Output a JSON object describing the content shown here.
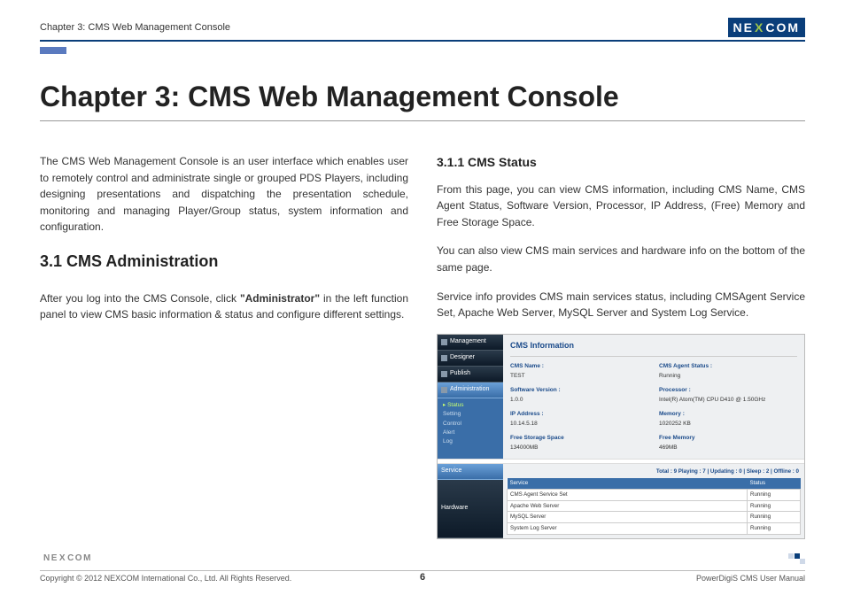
{
  "header": {
    "breadcrumb": "Chapter 3: CMS Web Management Console",
    "logo_pre": "NE",
    "logo_x": "X",
    "logo_post": "COM"
  },
  "title": "Chapter 3: CMS Web Management Console",
  "left": {
    "intro": "The CMS Web Management Console is an user interface which enables user to remotely control and administrate single or grouped PDS Players, including designing presentations and dispatching the presentation schedule, monitoring and managing Player/Group status, system information and configuration.",
    "h2": "3.1 CMS Administration",
    "p2a": "After you log into the CMS Console, click ",
    "p2b": "\"Administrator\"",
    "p2c": " in the left function panel to view CMS basic information & status and configure different settings."
  },
  "right": {
    "h3": "3.1.1 CMS Status",
    "p1": "From this page, you can view CMS information, including CMS Name, CMS Agent Status, Software Version, Processor, IP Address, (Free) Memory and Free Storage Space.",
    "p2": "You can also view CMS main services and hardware info on the bottom of the same page.",
    "p3": "Service info provides CMS main services status, including CMSAgent Service Set, Apache Web Server, MySQL Server and System Log Service."
  },
  "screenshot": {
    "sidebar": [
      "Management",
      "Designer",
      "Publish",
      "Administration"
    ],
    "submenu": [
      "Status",
      "Setting",
      "Control",
      "Alert",
      "Log"
    ],
    "info_title": "CMS Information",
    "fields": [
      {
        "label": "CMS Name :",
        "value": "TEST"
      },
      {
        "label": "CMS Agent Status :",
        "value": "Running"
      },
      {
        "label": "Software Version :",
        "value": "1.0.0"
      },
      {
        "label": "Processor :",
        "value": "Intel(R) Atom(TM) CPU D410 @ 1.50GHz"
      },
      {
        "label": "IP Address :",
        "value": "10.14.5.18"
      },
      {
        "label": "Memory :",
        "value": "1020252 KB"
      },
      {
        "label": "Free Storage Space",
        "value": "134000MB"
      },
      {
        "label": "Free Memory",
        "value": "469MB"
      }
    ],
    "side2": [
      "Service",
      "Hardware"
    ],
    "summary": "Total : 9   Playing : 7  |  Updating : 0  |  Sleep : 2  |  Offline : 0",
    "table": {
      "headers": [
        "Service",
        "Status"
      ],
      "rows": [
        [
          "CMS Agent Service Set",
          "Running"
        ],
        [
          "Apache Web Server",
          "Running"
        ],
        [
          "MySQL Server",
          "Running"
        ],
        [
          "System Log Server",
          "Running"
        ]
      ]
    }
  },
  "footer": {
    "copyright": "Copyright © 2012 NEXCOM International Co., Ltd. All Rights Reserved.",
    "page": "6",
    "manual": "PowerDigiS CMS User Manual"
  }
}
